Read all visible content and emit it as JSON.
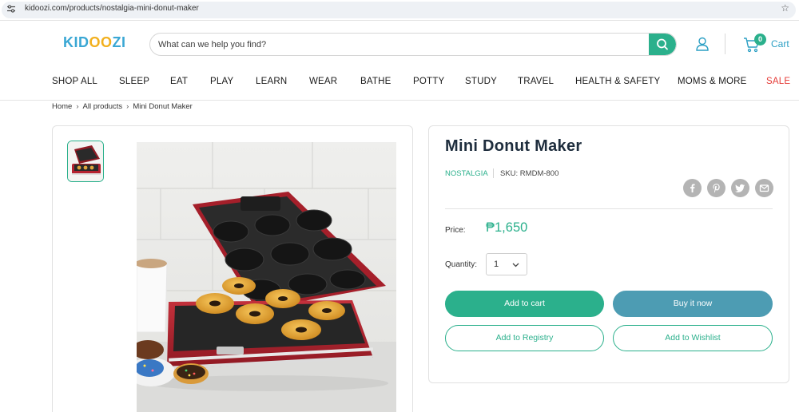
{
  "browser": {
    "url": "kidoozi.com/products/nostalgia-mini-donut-maker"
  },
  "header": {
    "logo_left": "KID",
    "logo_mid": "OO",
    "logo_right": "ZI",
    "search_placeholder": "What can we help you find?",
    "cart_count": "0",
    "cart_label": "Cart"
  },
  "nav": {
    "items": [
      {
        "label": "SHOP ALL"
      },
      {
        "label": "SLEEP"
      },
      {
        "label": "EAT"
      },
      {
        "label": "PLAY"
      },
      {
        "label": "LEARN"
      },
      {
        "label": "WEAR"
      },
      {
        "label": "BATHE"
      },
      {
        "label": "POTTY"
      },
      {
        "label": "STUDY"
      },
      {
        "label": "TRAVEL"
      },
      {
        "label": "HEALTH & SAFETY"
      },
      {
        "label": "MOMS & MORE"
      },
      {
        "label": "SALE"
      }
    ],
    "sale_color": "#e53935"
  },
  "breadcrumb": {
    "items": [
      "Home",
      "All products",
      "Mini Donut Maker"
    ],
    "separator": "›"
  },
  "product": {
    "title": "Mini Donut Maker",
    "vendor": "NOSTALGIA",
    "sku": "SKU: RMDM-800",
    "price_label": "Price:",
    "price": "₱1,650",
    "quantity_label": "Quantity:",
    "quantity_value": "1",
    "add_to_cart": "Add to cart",
    "buy_now": "Buy it now",
    "add_to_registry": "Add to Registry",
    "add_to_wishlist": "Add to Wishlist",
    "share_icons": [
      "facebook-icon",
      "pinterest-icon",
      "twitter-icon",
      "email-icon"
    ]
  },
  "colors": {
    "accent": "#2bb08c",
    "buy_now": "#4d9cb3",
    "appliance_red": "#b52330"
  }
}
